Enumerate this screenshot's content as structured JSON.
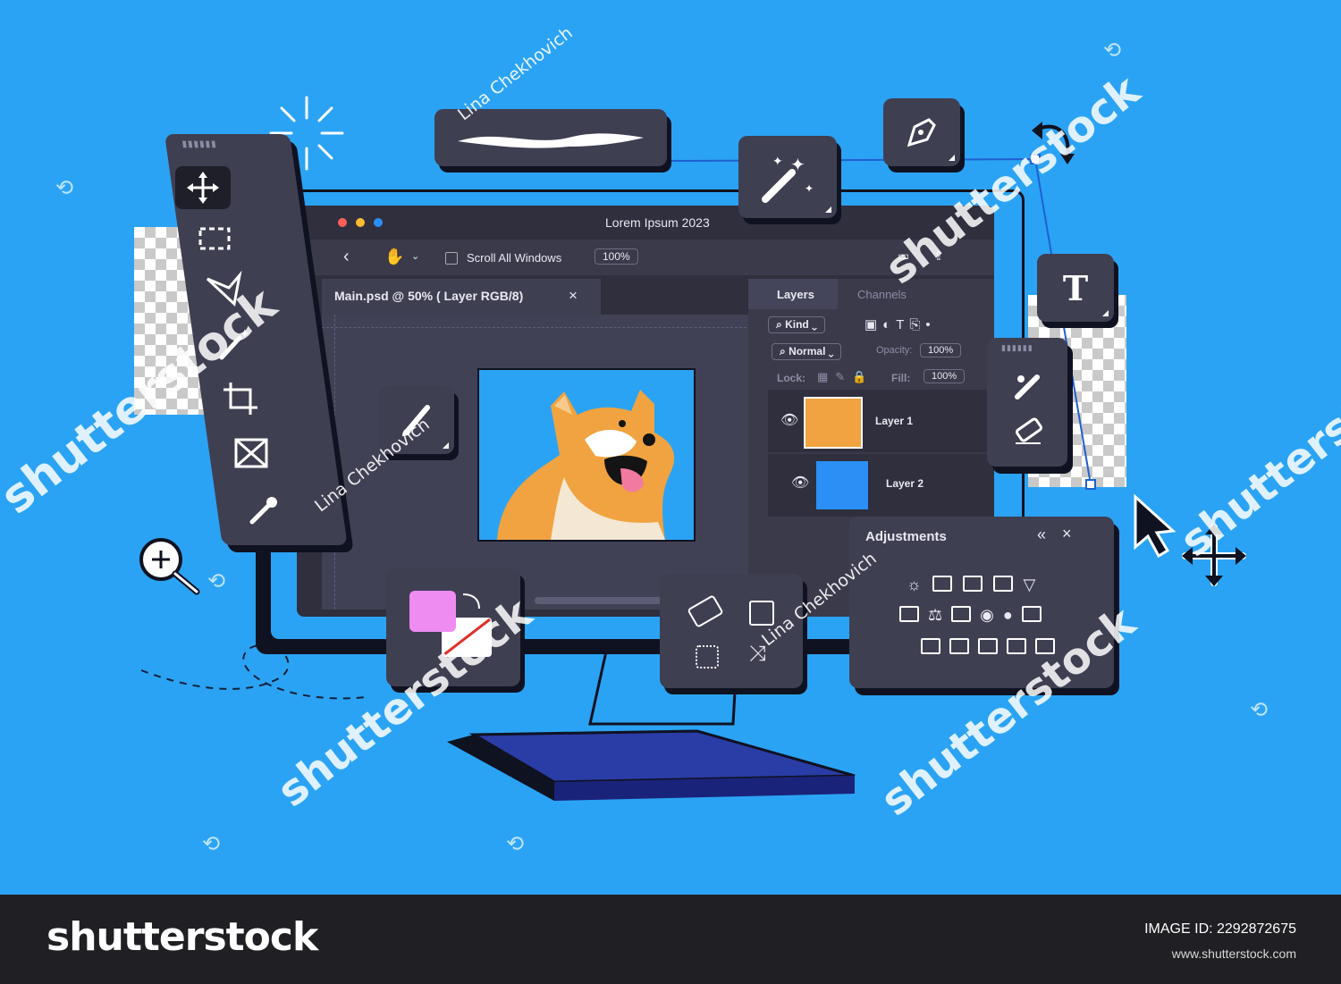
{
  "window": {
    "title": "Lorem Ipsum 2023",
    "traffic_lights": [
      "#ff5f57",
      "#febc2e",
      "#2b8ff5"
    ]
  },
  "toolbar": {
    "scroll_all_windows": "Scroll All Windows",
    "zoom": "100%"
  },
  "document_tab": {
    "label": "Main.psd @ 50% ( Layer RGB/8)",
    "close": "×"
  },
  "layers_panel": {
    "tabs": [
      "Layers",
      "Channels"
    ],
    "kind_label": "Kind",
    "blend_mode": "Normal",
    "opacity_label": "Opacity:",
    "opacity_value": "100%",
    "lock_label": "Lock:",
    "fill_label": "Fill:",
    "fill_value": "100%",
    "layers": [
      {
        "name": "Layer 1"
      },
      {
        "name": "Layer 2"
      }
    ]
  },
  "adjustments_panel": {
    "title": "Adjustments",
    "collapse": "«",
    "close": "×"
  },
  "tools": [
    "move-tool",
    "marquee-tool",
    "lasso-tool",
    "magic-wand-tool",
    "crop-tool",
    "frame-tool",
    "eyedropper-tool"
  ],
  "floating_tools": [
    "brush-stroke",
    "magic-wand",
    "pen-tool",
    "type-tool",
    "brush-tool",
    "healing-eraser",
    "color-swatch",
    "misc-tools",
    "zoom-tool",
    "move-cursor"
  ],
  "type_tool_glyph": "T",
  "watermarks": {
    "author": "Lina Chekhovich",
    "brand": "shutterstock"
  },
  "footer": {
    "logo": "shutterstock",
    "image_id": "IMAGE ID: 2292872675",
    "url": "www.shutterstock.com"
  },
  "colors": {
    "background": "#2ba3f4",
    "panel": "#3f3f52",
    "shadow": "#0f1220",
    "footer": "#1f1f24",
    "accent_blue": "#2b8ff5"
  }
}
